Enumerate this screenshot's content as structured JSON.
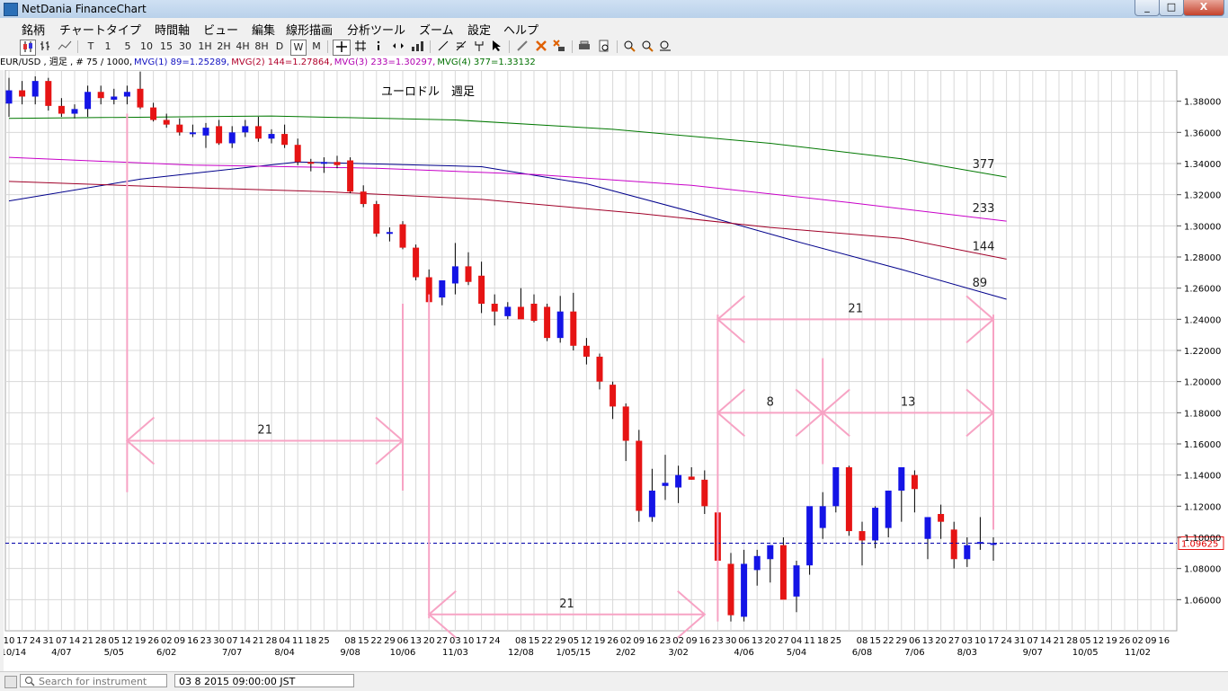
{
  "window": {
    "title": "NetDania FinanceChart",
    "minimize": "_",
    "maximize": "□",
    "close": "X"
  },
  "menu": [
    "銘柄",
    "チャートタイプ",
    "時間軸",
    "ビュー",
    "編集",
    "線形描画",
    "分析ツール",
    "ズーム",
    "設定",
    "ヘルプ"
  ],
  "toolbar": {
    "chart_icons": [
      "candle-chart-icon",
      "bar-chart-icon",
      "line-chart-icon"
    ],
    "intervals": [
      "T",
      "1",
      "5",
      "10",
      "15",
      "30",
      "1H",
      "2H",
      "4H",
      "8H",
      "D",
      "W",
      "M"
    ],
    "active_interval": "W",
    "tool_icons": [
      "crosshair-icon",
      "grid-icon",
      "info-icon",
      "scroll-icon",
      "volume-icon",
      "trendline-icon",
      "fibonacci-icon",
      "pitchfork-icon",
      "cursor-icon",
      "pen-icon",
      "delete-icon",
      "delete-all-icon",
      "print-icon",
      "print-preview-icon",
      "zoom-in-icon",
      "zoom-out-icon",
      "zoom-reset-icon"
    ]
  },
  "info": {
    "symbol": "EUR/USD , 週足 , # 75 / 1000,",
    "mvg1": "MVG(1) 89=1.25289,",
    "mvg2": "MVG(2) 144=1.27864,",
    "mvg3": "MVG(3) 233=1.30297,",
    "mvg4": "MVG(4) 377=1.33132"
  },
  "colors": {
    "bull": "#1414e6",
    "bear": "#e61414",
    "mvg1": "#00008b",
    "mvg2": "#a00028",
    "mvg3": "#c800c8",
    "mvg4": "#007800",
    "annotation": "#f7a3c4",
    "grid": "#d8d8d8",
    "price_line": "#0000aa"
  },
  "chart_data": {
    "type": "candlestick",
    "title": "ユーロドル　週足",
    "symbol": "EUR/USD",
    "interval": "週足",
    "current_price": "1.09625",
    "ylim": [
      1.04,
      1.4
    ],
    "y_ticks": [
      "1.38000",
      "1.36000",
      "1.34000",
      "1.32000",
      "1.30000",
      "1.28000",
      "1.26000",
      "1.24000",
      "1.22000",
      "1.20000",
      "1.18000",
      "1.16000",
      "1.14000",
      "1.12000",
      "1.10000",
      "1.08000",
      "1.06000"
    ],
    "x_day_labels": [
      "10",
      "17",
      "24",
      "31",
      "07",
      "14",
      "21",
      "28",
      "05",
      "12",
      "19",
      "26",
      "02",
      "09",
      "16",
      "23",
      "30",
      "07",
      "14",
      "21",
      "28",
      "04",
      "11",
      "18",
      "25",
      "",
      "08",
      "15",
      "22",
      "29",
      "06",
      "13",
      "20",
      "27",
      "03",
      "10",
      "17",
      "24",
      "",
      "08",
      "15",
      "22",
      "29",
      "05",
      "12",
      "19",
      "26",
      "02",
      "09",
      "16",
      "23",
      "02",
      "09",
      "16",
      "23",
      "30",
      "06",
      "13",
      "20",
      "27",
      "04",
      "11",
      "18",
      "25",
      "",
      "08",
      "15",
      "22",
      "29",
      "06",
      "13",
      "20",
      "27",
      "03",
      "10",
      "17",
      "24",
      "31",
      "07",
      "14",
      "21",
      "28",
      "05",
      "12",
      "19",
      "26",
      "02",
      "09",
      "16"
    ],
    "x_month_labels": [
      {
        "i": 0,
        "text": "3/10/14"
      },
      {
        "i": 4,
        "text": "4/07"
      },
      {
        "i": 8,
        "text": "5/05"
      },
      {
        "i": 12,
        "text": "6/02"
      },
      {
        "i": 17,
        "text": "7/07"
      },
      {
        "i": 21,
        "text": "8/04"
      },
      {
        "i": 26,
        "text": "9/08"
      },
      {
        "i": 30,
        "text": "10/06"
      },
      {
        "i": 34,
        "text": "11/03"
      },
      {
        "i": 39,
        "text": "12/08"
      },
      {
        "i": 43,
        "text": "1/05/15"
      },
      {
        "i": 47,
        "text": "2/02"
      },
      {
        "i": 51,
        "text": "3/02"
      },
      {
        "i": 56,
        "text": "4/06"
      },
      {
        "i": 60,
        "text": "5/04"
      },
      {
        "i": 65,
        "text": "6/08"
      },
      {
        "i": 69,
        "text": "7/06"
      },
      {
        "i": 73,
        "text": "8/03"
      },
      {
        "i": 78,
        "text": "9/07"
      },
      {
        "i": 82,
        "text": "10/05"
      },
      {
        "i": 86,
        "text": "11/02"
      }
    ],
    "ohlc": [
      [
        1.3785,
        1.395,
        1.37,
        1.387
      ],
      [
        1.387,
        1.393,
        1.378,
        1.383
      ],
      [
        1.383,
        1.396,
        1.378,
        1.393
      ],
      [
        1.393,
        1.395,
        1.374,
        1.377
      ],
      [
        1.377,
        1.382,
        1.37,
        1.372
      ],
      [
        1.372,
        1.378,
        1.369,
        1.375
      ],
      [
        1.375,
        1.39,
        1.37,
        1.386
      ],
      [
        1.386,
        1.39,
        1.378,
        1.382
      ],
      [
        1.381,
        1.388,
        1.378,
        1.383
      ],
      [
        1.383,
        1.39,
        1.378,
        1.386
      ],
      [
        1.388,
        1.399,
        1.375,
        1.376
      ],
      [
        1.376,
        1.379,
        1.367,
        1.368
      ],
      [
        1.368,
        1.372,
        1.363,
        1.365
      ],
      [
        1.365,
        1.369,
        1.358,
        1.36
      ],
      [
        1.36,
        1.365,
        1.357,
        1.36
      ],
      [
        1.358,
        1.366,
        1.35,
        1.363
      ],
      [
        1.364,
        1.368,
        1.352,
        1.353
      ],
      [
        1.353,
        1.364,
        1.35,
        1.36
      ],
      [
        1.36,
        1.368,
        1.357,
        1.364
      ],
      [
        1.364,
        1.37,
        1.354,
        1.356
      ],
      [
        1.356,
        1.362,
        1.353,
        1.359
      ],
      [
        1.359,
        1.365,
        1.35,
        1.352
      ],
      [
        1.352,
        1.356,
        1.339,
        1.341
      ],
      [
        1.341,
        1.343,
        1.335,
        1.34
      ],
      [
        1.34,
        1.344,
        1.334,
        1.341
      ],
      [
        1.341,
        1.345,
        1.337,
        1.339
      ],
      [
        1.342,
        1.344,
        1.321,
        1.322
      ],
      [
        1.322,
        1.326,
        1.312,
        1.314
      ],
      [
        1.314,
        1.316,
        1.293,
        1.295
      ],
      [
        1.296,
        1.299,
        1.29,
        1.296
      ],
      [
        1.301,
        1.303,
        1.285,
        1.286
      ],
      [
        1.286,
        1.288,
        1.265,
        1.267
      ],
      [
        1.267,
        1.272,
        1.25,
        1.251
      ],
      [
        1.254,
        1.264,
        1.249,
        1.265
      ],
      [
        1.263,
        1.289,
        1.256,
        1.274
      ],
      [
        1.274,
        1.283,
        1.262,
        1.264
      ],
      [
        1.268,
        1.277,
        1.244,
        1.25
      ],
      [
        1.25,
        1.256,
        1.236,
        1.245
      ],
      [
        1.242,
        1.251,
        1.24,
        1.248
      ],
      [
        1.248,
        1.26,
        1.244,
        1.24
      ],
      [
        1.25,
        1.256,
        1.238,
        1.239
      ],
      [
        1.248,
        1.25,
        1.226,
        1.228
      ],
      [
        1.228,
        1.255,
        1.225,
        1.245
      ],
      [
        1.245,
        1.257,
        1.22,
        1.223
      ],
      [
        1.223,
        1.228,
        1.211,
        1.216
      ],
      [
        1.216,
        1.218,
        1.195,
        1.2
      ],
      [
        1.198,
        1.2,
        1.176,
        1.184
      ],
      [
        1.184,
        1.186,
        1.149,
        1.162
      ],
      [
        1.162,
        1.169,
        1.11,
        1.117
      ],
      [
        1.113,
        1.144,
        1.11,
        1.13
      ],
      [
        1.133,
        1.153,
        1.124,
        1.135
      ],
      [
        1.132,
        1.146,
        1.122,
        1.14
      ],
      [
        1.139,
        1.145,
        1.137,
        1.137
      ],
      [
        1.137,
        1.143,
        1.115,
        1.12
      ],
      [
        1.116,
        1.122,
        1.084,
        1.085
      ],
      [
        1.083,
        1.09,
        1.046,
        1.05
      ],
      [
        1.049,
        1.092,
        1.046,
        1.083
      ],
      [
        1.079,
        1.092,
        1.069,
        1.088
      ],
      [
        1.086,
        1.095,
        1.071,
        1.095
      ],
      [
        1.095,
        1.1,
        1.066,
        1.06
      ],
      [
        1.062,
        1.085,
        1.052,
        1.082
      ],
      [
        1.082,
        1.103,
        1.076,
        1.12
      ],
      [
        1.106,
        1.129,
        1.099,
        1.12
      ],
      [
        1.12,
        1.139,
        1.116,
        1.145
      ],
      [
        1.145,
        1.146,
        1.101,
        1.104
      ],
      [
        1.104,
        1.11,
        1.082,
        1.098
      ],
      [
        1.098,
        1.12,
        1.093,
        1.119
      ],
      [
        1.106,
        1.128,
        1.1,
        1.13
      ],
      [
        1.13,
        1.144,
        1.11,
        1.145
      ],
      [
        1.14,
        1.143,
        1.116,
        1.131
      ],
      [
        1.099,
        1.111,
        1.086,
        1.113
      ],
      [
        1.115,
        1.121,
        1.099,
        1.11
      ],
      [
        1.105,
        1.11,
        1.08,
        1.086
      ],
      [
        1.086,
        1.1,
        1.081,
        1.095
      ],
      [
        1.096,
        1.113,
        1.092,
        1.097
      ],
      [
        1.096,
        1.1,
        1.085,
        1.0963
      ]
    ],
    "series": [
      {
        "name": "MVG(1) 89",
        "label": "89",
        "color": "#00008b",
        "start": 1.316,
        "end": 1.2529,
        "points": [
          [
            0,
            1.316
          ],
          [
            10,
            1.33
          ],
          [
            22,
            1.341
          ],
          [
            36,
            1.338
          ],
          [
            44,
            1.327
          ],
          [
            52,
            1.309
          ],
          [
            60,
            1.29
          ],
          [
            68,
            1.272
          ],
          [
            76,
            1.2529
          ]
        ]
      },
      {
        "name": "MVG(2) 144",
        "label": "144",
        "color": "#a00028",
        "start": 1.3285,
        "end": 1.27864,
        "points": [
          [
            0,
            1.3285
          ],
          [
            12,
            1.325
          ],
          [
            24,
            1.322
          ],
          [
            36,
            1.317
          ],
          [
            48,
            1.308
          ],
          [
            58,
            1.299
          ],
          [
            68,
            1.292
          ],
          [
            76,
            1.2786
          ]
        ]
      },
      {
        "name": "MVG(3) 233",
        "label": "233",
        "color": "#c800c8",
        "start": 1.344,
        "end": 1.30297,
        "points": [
          [
            0,
            1.344
          ],
          [
            14,
            1.339
          ],
          [
            28,
            1.337
          ],
          [
            40,
            1.333
          ],
          [
            52,
            1.326
          ],
          [
            64,
            1.315
          ],
          [
            76,
            1.303
          ]
        ]
      },
      {
        "name": "MVG(4) 377",
        "label": "377",
        "color": "#007800",
        "start": 1.369,
        "end": 1.33132,
        "points": [
          [
            0,
            1.369
          ],
          [
            20,
            1.3705
          ],
          [
            34,
            1.368
          ],
          [
            46,
            1.362
          ],
          [
            58,
            1.353
          ],
          [
            68,
            1.343
          ],
          [
            76,
            1.3313
          ]
        ]
      }
    ],
    "annotations": [
      {
        "type": "span",
        "label": "21",
        "from": 9,
        "to": 30,
        "price": 1.162
      },
      {
        "type": "span",
        "label": "21",
        "from": 32,
        "to": 53,
        "price": 1.0505
      },
      {
        "type": "span",
        "label": "21",
        "from": 54,
        "to": 75,
        "price": 1.24
      },
      {
        "type": "span",
        "label": "8",
        "from": 54,
        "to": 62,
        "price": 1.18
      },
      {
        "type": "span",
        "label": "13",
        "from": 62,
        "to": 75,
        "price": 1.18
      }
    ]
  },
  "status": {
    "search_placeholder": "Search for instrument",
    "time": "03 8 2015 09:00:00 JST"
  }
}
